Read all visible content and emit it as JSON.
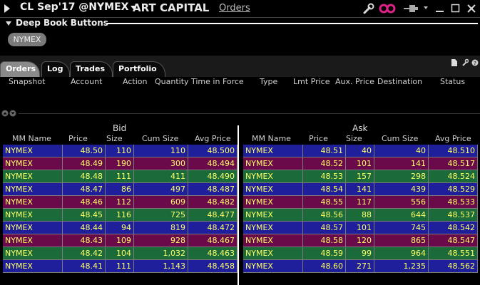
{
  "titlebar": {
    "ticker": "CL Sep'17 @NYMEX",
    "company": "ART CAPITAL",
    "orders_link": "Orders"
  },
  "deep_book": {
    "label": "Deep Book Buttons",
    "button": "NYMEX"
  },
  "tabs": [
    "Orders",
    "Log",
    "Trades",
    "Portfolio"
  ],
  "orders_columns": [
    "Snapshot",
    "Account",
    "Action",
    "Quantity",
    "Time in Force",
    "Type",
    "Lmt Price",
    "Aux. Price",
    "Destination",
    "Status"
  ],
  "book": {
    "bid_title": "Bid",
    "ask_title": "Ask",
    "columns": [
      "MM Name",
      "Price",
      "Size",
      "Cum Size",
      "Avg Price"
    ],
    "bid_rows": [
      {
        "mm": "NYMEX",
        "price": "48.50",
        "size": "110",
        "cum": "110",
        "avg": "48.500",
        "color": "blue"
      },
      {
        "mm": "NYMEX",
        "price": "48.49",
        "size": "190",
        "cum": "300",
        "avg": "48.494",
        "color": "purple"
      },
      {
        "mm": "NYMEX",
        "price": "48.48",
        "size": "111",
        "cum": "411",
        "avg": "48.490",
        "color": "green"
      },
      {
        "mm": "NYMEX",
        "price": "48.47",
        "size": "86",
        "cum": "497",
        "avg": "48.487",
        "color": "blue"
      },
      {
        "mm": "NYMEX",
        "price": "48.46",
        "size": "112",
        "cum": "609",
        "avg": "48.482",
        "color": "purple"
      },
      {
        "mm": "NYMEX",
        "price": "48.45",
        "size": "116",
        "cum": "725",
        "avg": "48.477",
        "color": "green"
      },
      {
        "mm": "NYMEX",
        "price": "48.44",
        "size": "94",
        "cum": "819",
        "avg": "48.472",
        "color": "blue"
      },
      {
        "mm": "NYMEX",
        "price": "48.43",
        "size": "109",
        "cum": "928",
        "avg": "48.467",
        "color": "purple"
      },
      {
        "mm": "NYMEX",
        "price": "48.42",
        "size": "104",
        "cum": "1,032",
        "avg": "48.463",
        "color": "green"
      },
      {
        "mm": "NYMEX",
        "price": "48.41",
        "size": "111",
        "cum": "1,143",
        "avg": "48.458",
        "color": "blue"
      }
    ],
    "ask_rows": [
      {
        "mm": "NYMEX",
        "price": "48.51",
        "size": "40",
        "cum": "40",
        "avg": "48.510",
        "color": "blue"
      },
      {
        "mm": "NYMEX",
        "price": "48.52",
        "size": "101",
        "cum": "141",
        "avg": "48.517",
        "color": "purple"
      },
      {
        "mm": "NYMEX",
        "price": "48.53",
        "size": "157",
        "cum": "298",
        "avg": "48.524",
        "color": "green"
      },
      {
        "mm": "NYMEX",
        "price": "48.54",
        "size": "141",
        "cum": "439",
        "avg": "48.529",
        "color": "blue"
      },
      {
        "mm": "NYMEX",
        "price": "48.55",
        "size": "117",
        "cum": "556",
        "avg": "48.533",
        "color": "purple"
      },
      {
        "mm": "NYMEX",
        "price": "48.56",
        "size": "88",
        "cum": "644",
        "avg": "48.537",
        "color": "green"
      },
      {
        "mm": "NYMEX",
        "price": "48.57",
        "size": "101",
        "cum": "745",
        "avg": "48.542",
        "color": "blue"
      },
      {
        "mm": "NYMEX",
        "price": "48.58",
        "size": "120",
        "cum": "865",
        "avg": "48.547",
        "color": "purple"
      },
      {
        "mm": "NYMEX",
        "price": "48.59",
        "size": "99",
        "cum": "964",
        "avg": "48.551",
        "color": "green"
      },
      {
        "mm": "NYMEX",
        "price": "48.60",
        "size": "271",
        "cum": "1,235",
        "avg": "48.562",
        "color": "blue"
      }
    ]
  },
  "colors": {
    "blue": "#1f1f9c",
    "purple": "#6a0a4a",
    "green": "#1a6a3a",
    "text": "#ffff66",
    "link_icon": "#e0218a"
  },
  "icons": [
    "play-icon",
    "chevron-down-icon",
    "wrench-icon",
    "link-icon",
    "pin-icon",
    "minimize-icon",
    "maximize-icon",
    "close-icon",
    "document-icon",
    "tools-icon",
    "help-icon",
    "scroll-up-icon",
    "scroll-down-icon"
  ]
}
